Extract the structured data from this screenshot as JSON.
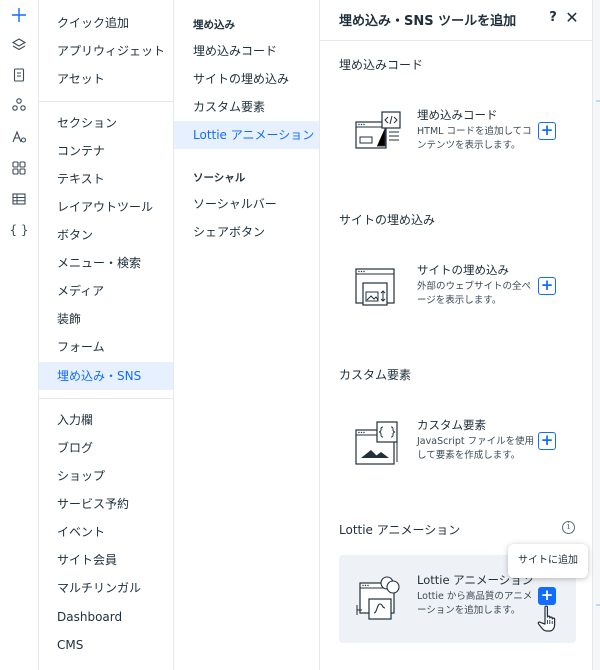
{
  "rail": {
    "icons": [
      "plus-icon",
      "layers-icon",
      "page-icon",
      "apps-icon",
      "theme-icon",
      "grid-icon",
      "table-icon",
      "code-icon"
    ],
    "code_glyph": "{ }"
  },
  "categories": {
    "group1": [
      "クイック追加",
      "アプリウィジェット",
      "アセット"
    ],
    "group2": [
      "セクション",
      "コンテナ",
      "テキスト",
      "レイアウトツール",
      "ボタン",
      "メニュー・検索",
      "メディア",
      "装飾",
      "フォーム",
      "埋め込み・SNS"
    ],
    "group3": [
      "入力欄",
      "ブログ",
      "ショップ",
      "サービス予約",
      "イベント",
      "サイト会員",
      "マルチリンガル",
      "Dashboard",
      "CMS"
    ],
    "selected": "埋め込み・SNS"
  },
  "subcategories": {
    "embed_heading": "埋め込み",
    "embed_items": [
      "埋め込みコード",
      "サイトの埋め込み",
      "カスタム要素",
      "Lottie アニメーション"
    ],
    "social_heading": "ソーシャル",
    "social_items": [
      "ソーシャルバー",
      "シェアボタン"
    ],
    "selected": "Lottie アニメーション"
  },
  "panel": {
    "title": "埋め込み・SNS ツールを追加",
    "help": "?",
    "close": "✕",
    "sections": [
      {
        "heading": "埋め込みコード",
        "card_title": "埋め込みコード",
        "card_desc": "HTML コードを追加してコンテンツを表示します。"
      },
      {
        "heading": "サイトの埋め込み",
        "card_title": "サイトの埋め込み",
        "card_desc": "外部のウェブサイトの全ページを表示します。"
      },
      {
        "heading": "カスタム要素",
        "card_title": "カスタム要素",
        "card_desc": "JavaScript ファイルを使用して要素を作成します。"
      },
      {
        "heading": "Lottie アニメーション",
        "card_title": "Lottie アニメーション",
        "card_desc": "Lottie から高品質のアニメーションを追加します。"
      }
    ],
    "add_glyph": "+",
    "info_glyph": "i"
  },
  "tooltip": {
    "text": "サイトに追加"
  },
  "colors": {
    "accent": "#116dff",
    "selected_bg": "#e7f0ff",
    "card_hover": "#eef1f5"
  }
}
